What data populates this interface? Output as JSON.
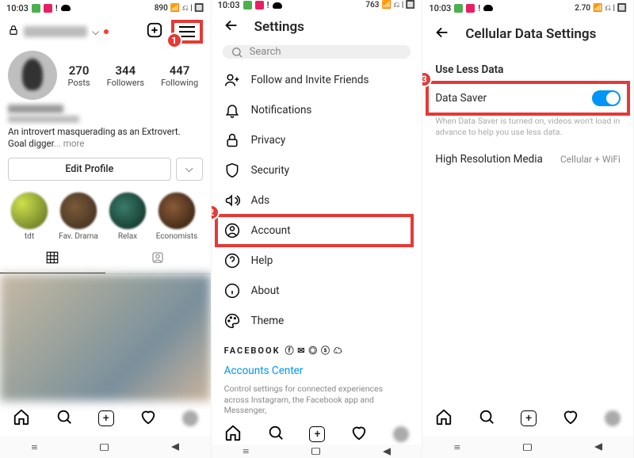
{
  "status": {
    "time": "10:03",
    "data1": "890",
    "data2": "763",
    "data3": "2.70"
  },
  "profile": {
    "stats": [
      {
        "num": "270",
        "label": "Posts"
      },
      {
        "num": "344",
        "label": "Followers"
      },
      {
        "num": "447",
        "label": "Following"
      }
    ],
    "bio_line1": "An introvert masquerading as an Extrovert.",
    "bio_line2_prefix": "Goal digger",
    "more_label": "... more",
    "edit_label": "Edit Profile",
    "highlights": [
      {
        "label": "tdt"
      },
      {
        "label": "Fav. Drama"
      },
      {
        "label": "Relax"
      },
      {
        "label": "Economists"
      }
    ]
  },
  "settings": {
    "title": "Settings",
    "search_placeholder": "Search",
    "items": [
      {
        "label": "Follow and Invite Friends"
      },
      {
        "label": "Notifications"
      },
      {
        "label": "Privacy"
      },
      {
        "label": "Security"
      },
      {
        "label": "Ads"
      },
      {
        "label": "Account"
      },
      {
        "label": "Help"
      },
      {
        "label": "About"
      },
      {
        "label": "Theme"
      }
    ],
    "fb_title": "FACEBOOK",
    "accounts_center": "Accounts Center",
    "fb_desc": "Control settings for connected experiences across Instagram, the Facebook app and Messenger,"
  },
  "cellular": {
    "title": "Cellular Data Settings",
    "section1": "Use Less Data",
    "datasaver": "Data Saver",
    "datasaver_desc": "When Data Saver is turned on, videos won't load in advance to help you use less data.",
    "hires_label": "High Resolution Media",
    "hires_value": "Cellular + WiFi"
  },
  "callouts": {
    "c1": "1",
    "c2": "2",
    "c3": "3"
  }
}
